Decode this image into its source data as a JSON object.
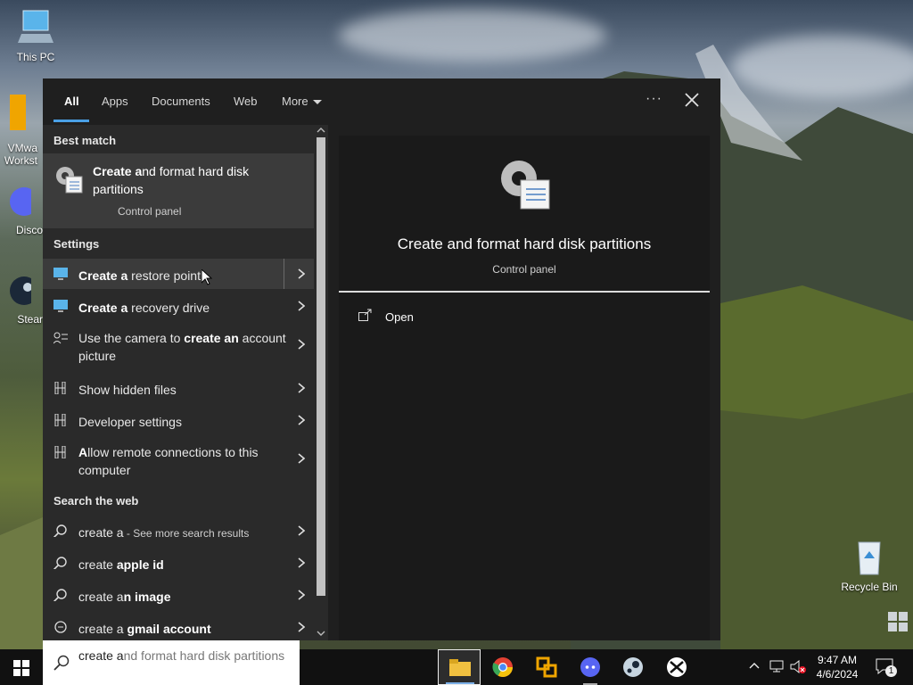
{
  "desktop": {
    "icons": [
      {
        "label": "This PC"
      },
      {
        "label": "VMwa"
      },
      {
        "label": "Workst"
      },
      {
        "label": "Disco"
      },
      {
        "label": "Stear"
      },
      {
        "label": "Recycle Bin"
      }
    ]
  },
  "search_panel": {
    "tabs": [
      {
        "label": "All"
      },
      {
        "label": "Apps"
      },
      {
        "label": "Documents"
      },
      {
        "label": "Web"
      },
      {
        "label": "More"
      }
    ],
    "sections": {
      "best_match": "Best match",
      "settings": "Settings",
      "web": "Search the web"
    },
    "best_match": {
      "bold": "Create a",
      "rest": "nd format hard disk partitions",
      "subtitle": "Control panel"
    },
    "settings_items": [
      {
        "bold": "Create a",
        "rest": " restore point"
      },
      {
        "bold": "Create a",
        "rest": " recovery drive"
      },
      {
        "pre": "Use the camera to ",
        "bold": "create an",
        "rest": " account picture"
      },
      {
        "pre": "Show hidden files"
      },
      {
        "pre": "Developer settings"
      },
      {
        "pre": "A",
        "bold": "llow remote connections to this computer",
        "rest": ""
      }
    ],
    "web_items": [
      {
        "pre": "create a",
        "suffix": " - See more search results"
      },
      {
        "pre": "create ",
        "bold": "apple id"
      },
      {
        "pre": "create a",
        "bold": "n image"
      },
      {
        "pre": "create a ",
        "bold": "gmail account"
      }
    ],
    "preview": {
      "title": "Create and format hard disk partitions",
      "subtitle": "Control panel",
      "open_label": "Open"
    }
  },
  "taskbar": {
    "search_typed": "create a",
    "search_suggestion": "nd format hard disk partitions",
    "time": "9:47 AM",
    "date": "4/6/2024",
    "notification_count": "1"
  },
  "colors": {
    "panel_bg": "#1f1f1f",
    "accent": "#4aa0e6"
  }
}
